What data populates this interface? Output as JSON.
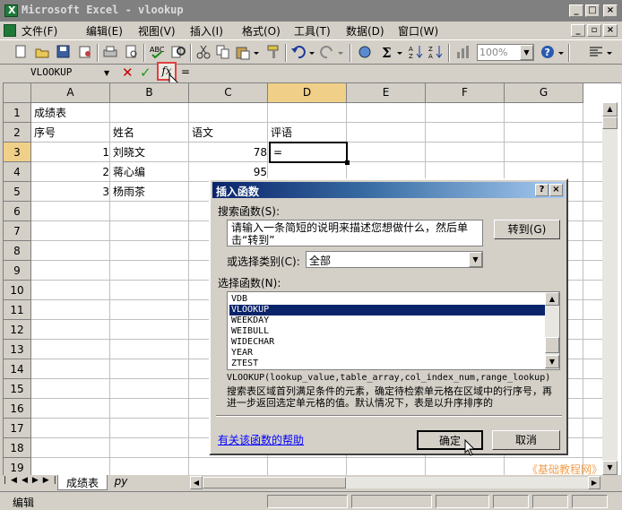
{
  "window": {
    "title": "Microsoft Excel - vlookup"
  },
  "menubar": [
    "文件(F)",
    "编辑(E)",
    "视图(V)",
    "插入(I)",
    "格式(O)",
    "工具(T)",
    "数据(D)",
    "窗口(W)"
  ],
  "toolbar": {
    "zoom": "100%"
  },
  "formula_bar": {
    "name_box": "VLOOKUP",
    "content": "="
  },
  "columns": [
    "A",
    "B",
    "C",
    "D",
    "E",
    "F",
    "G"
  ],
  "rows": [
    "1",
    "2",
    "3",
    "4",
    "5",
    "6",
    "7",
    "8",
    "9",
    "10",
    "11",
    "12",
    "13",
    "14",
    "15",
    "16",
    "17",
    "18",
    "19"
  ],
  "cells": {
    "A1": "成绩表",
    "A2": "序号",
    "B2": "姓名",
    "C2": "语文",
    "D2": "评语",
    "A3": "1",
    "B3": "刘晓文",
    "C3": "78",
    "D3": "=",
    "A4": "2",
    "B4": "蒋心编",
    "C4": "95",
    "A5": "3",
    "B5": "杨雨茶"
  },
  "sheet_tabs": [
    "成绩表",
    "py"
  ],
  "status_bar": {
    "text": "编辑"
  },
  "watermark": "《基础教程网》",
  "dialog": {
    "title": "插入函数",
    "search_label": "搜索函数(S):",
    "search_text": "请输入一条简短的说明来描述您想做什么，然后单击“转到”",
    "go_button": "转到(G)",
    "category_label": "或选择类别(C):",
    "category_value": "全部",
    "function_label": "选择函数(N):",
    "functions": [
      "VDB",
      "VLOOKUP",
      "WEEKDAY",
      "WEIBULL",
      "WIDECHAR",
      "YEAR",
      "ZTEST"
    ],
    "selected_function": "VLOOKUP",
    "syntax": "VLOOKUP(lookup_value,table_array,col_index_num,range_lookup)",
    "description": "搜索表区域首列满足条件的元素，确定待检索单元格在区域中的行序号，再进一步返回选定单元格的值。默认情况下，表是以升序排序的",
    "help_link": "有关该函数的帮助",
    "ok_button": "确定",
    "cancel_button": "取消"
  }
}
